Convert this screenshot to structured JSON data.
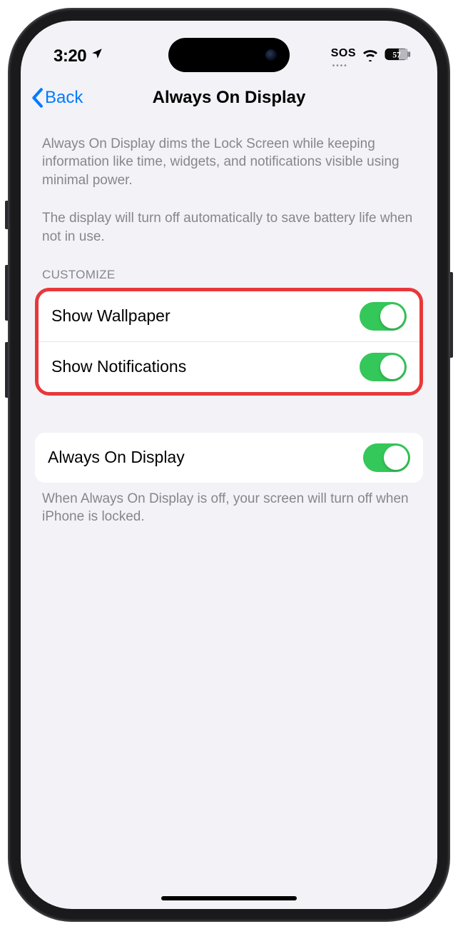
{
  "status_bar": {
    "time": "3:20",
    "sos": "SOS",
    "battery_percent": "57"
  },
  "nav": {
    "back_label": "Back",
    "title": "Always On Display"
  },
  "description": {
    "p1": "Always On Display dims the Lock Screen while keeping information like time, widgets, and notifications visible using minimal power.",
    "p2": "The display will turn off automatically to save battery life when not in use."
  },
  "sections": {
    "customize_header": "CUSTOMIZE",
    "rows": {
      "show_wallpaper": {
        "label": "Show Wallpaper",
        "on": true
      },
      "show_notifications": {
        "label": "Show Notifications",
        "on": true
      },
      "always_on_display": {
        "label": "Always On Display",
        "on": true
      }
    }
  },
  "footer": "When Always On Display is off, your screen will turn off when iPhone is locked."
}
